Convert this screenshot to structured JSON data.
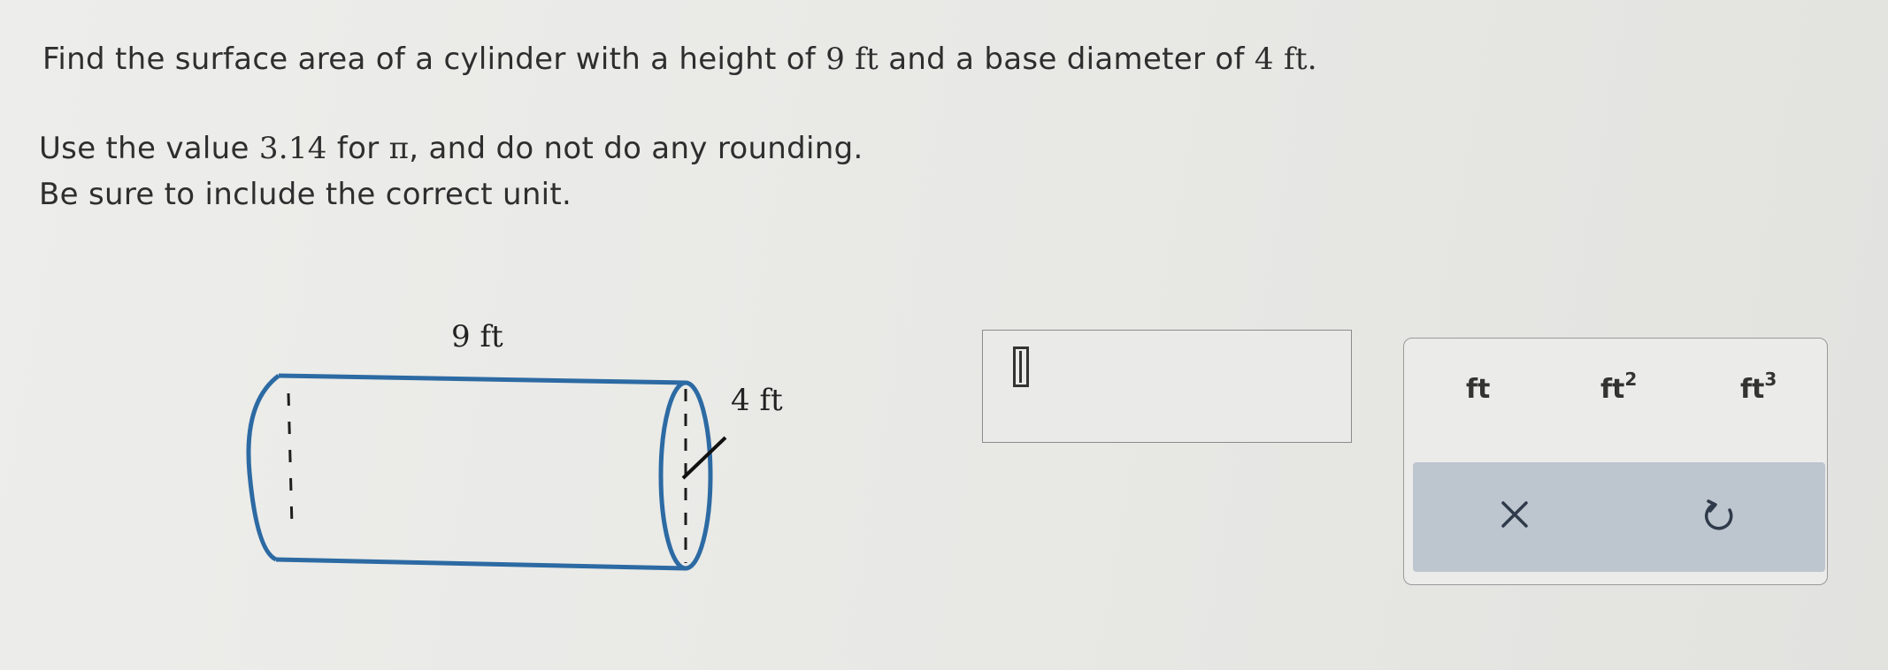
{
  "question": {
    "prefix": "Find the surface area of a cylinder with a height of ",
    "height_value": "9",
    "height_unit": "ft",
    "middle": " and a base diameter of ",
    "diameter_value": "4",
    "diameter_unit": "ft",
    "suffix": "."
  },
  "instructions": {
    "line1_prefix": "Use the value ",
    "pi_value": "3.14",
    "line1_middle": " for ",
    "pi_symbol": "π",
    "line1_suffix": ", and do not do any rounding.",
    "line2": "Be sure to include the correct unit."
  },
  "figure": {
    "height_label": "9 ft",
    "diameter_label": "4 ft"
  },
  "answer": {
    "value": ""
  },
  "units_panel": {
    "options": [
      {
        "base": "ft",
        "exponent": ""
      },
      {
        "base": "ft",
        "exponent": "2"
      },
      {
        "base": "ft",
        "exponent": "3"
      }
    ],
    "clear_icon": "x-icon",
    "undo_icon": "undo-icon"
  }
}
